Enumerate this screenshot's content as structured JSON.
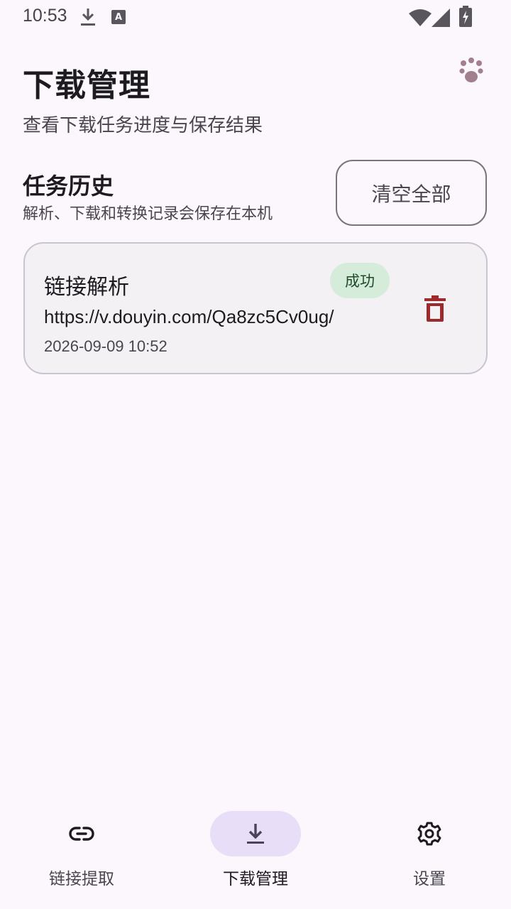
{
  "status_bar": {
    "time": "10:53",
    "icons": [
      "download-icon",
      "keyboard-a-icon",
      "wifi-icon",
      "signal-icon",
      "battery-charging-icon"
    ]
  },
  "header": {
    "title": "下载管理",
    "subtitle": "查看下载任务进度与保存结果",
    "action_icon": "paw-icon"
  },
  "history": {
    "title": "任务历史",
    "subtitle": "解析、下载和转换记录会保存在本机",
    "clear_label": "清空全部"
  },
  "tasks": [
    {
      "type": "链接解析",
      "status": "成功",
      "url": "https://v.douyin.com/Qa8zc5Cv0ug/",
      "time": "2026-09-09 10:52",
      "action_icon": "delete-icon"
    }
  ],
  "bottom_nav": {
    "items": [
      {
        "label": "链接提取",
        "icon": "link-icon",
        "active": false
      },
      {
        "label": "下载管理",
        "icon": "download-icon",
        "active": true
      },
      {
        "label": "设置",
        "icon": "gear-icon",
        "active": false
      }
    ]
  },
  "colors": {
    "background": "#fcf7fc",
    "card_background": "#f4f1f5",
    "success_badge": "#d4ecd9",
    "delete_red": "#9e2a2b",
    "active_nav_pill": "#e8def8",
    "paw_icon": "#a27f8c"
  }
}
